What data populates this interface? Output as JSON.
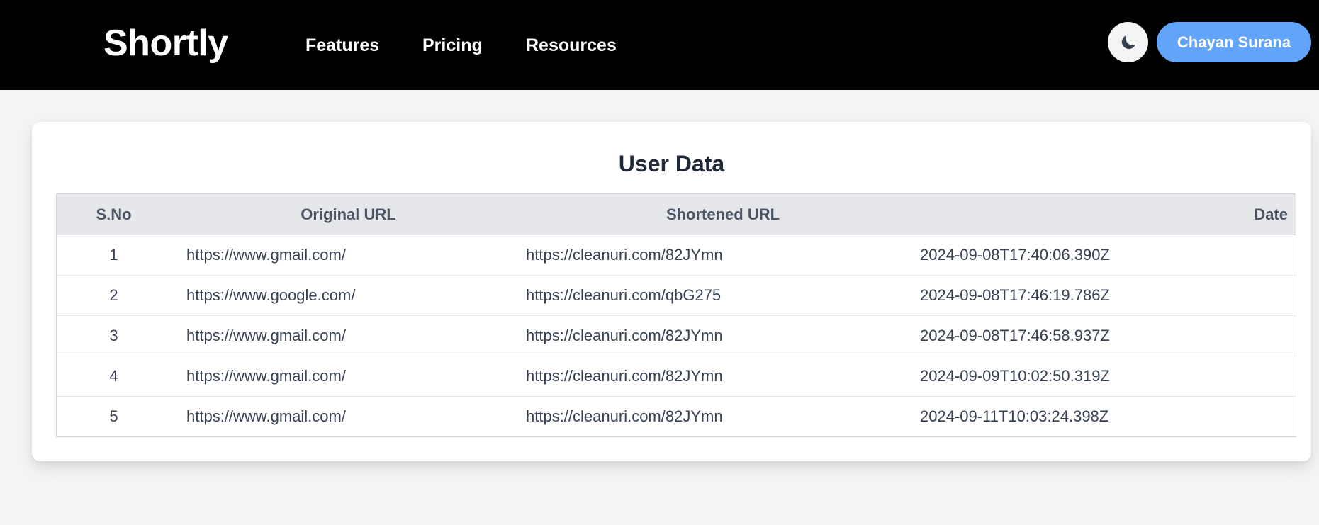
{
  "nav": {
    "logo": "Shortly",
    "links": [
      "Features",
      "Pricing",
      "Resources"
    ],
    "theme_toggle_icon": "moon-icon",
    "user_name": "Chayan Surana"
  },
  "colors": {
    "navbar_bg": "#000000",
    "page_bg": "#f3f4f6",
    "user_button_bg": "#60a5fa",
    "table_header_bg": "#e5e7eb"
  },
  "card": {
    "title": "User Data"
  },
  "table": {
    "headers": [
      "S.No",
      "Original URL",
      "Shortened URL",
      "Date"
    ],
    "rows": [
      {
        "sno": "1",
        "original": "https://www.gmail.com/",
        "short": "https://cleanuri.com/82JYmn",
        "date": "2024-09-08T17:40:06.390Z"
      },
      {
        "sno": "2",
        "original": "https://www.google.com/",
        "short": "https://cleanuri.com/qbG275",
        "date": "2024-09-08T17:46:19.786Z"
      },
      {
        "sno": "3",
        "original": "https://www.gmail.com/",
        "short": "https://cleanuri.com/82JYmn",
        "date": "2024-09-08T17:46:58.937Z"
      },
      {
        "sno": "4",
        "original": "https://www.gmail.com/",
        "short": "https://cleanuri.com/82JYmn",
        "date": "2024-09-09T10:02:50.319Z"
      },
      {
        "sno": "5",
        "original": "https://www.gmail.com/",
        "short": "https://cleanuri.com/82JYmn",
        "date": "2024-09-11T10:03:24.398Z"
      }
    ]
  }
}
